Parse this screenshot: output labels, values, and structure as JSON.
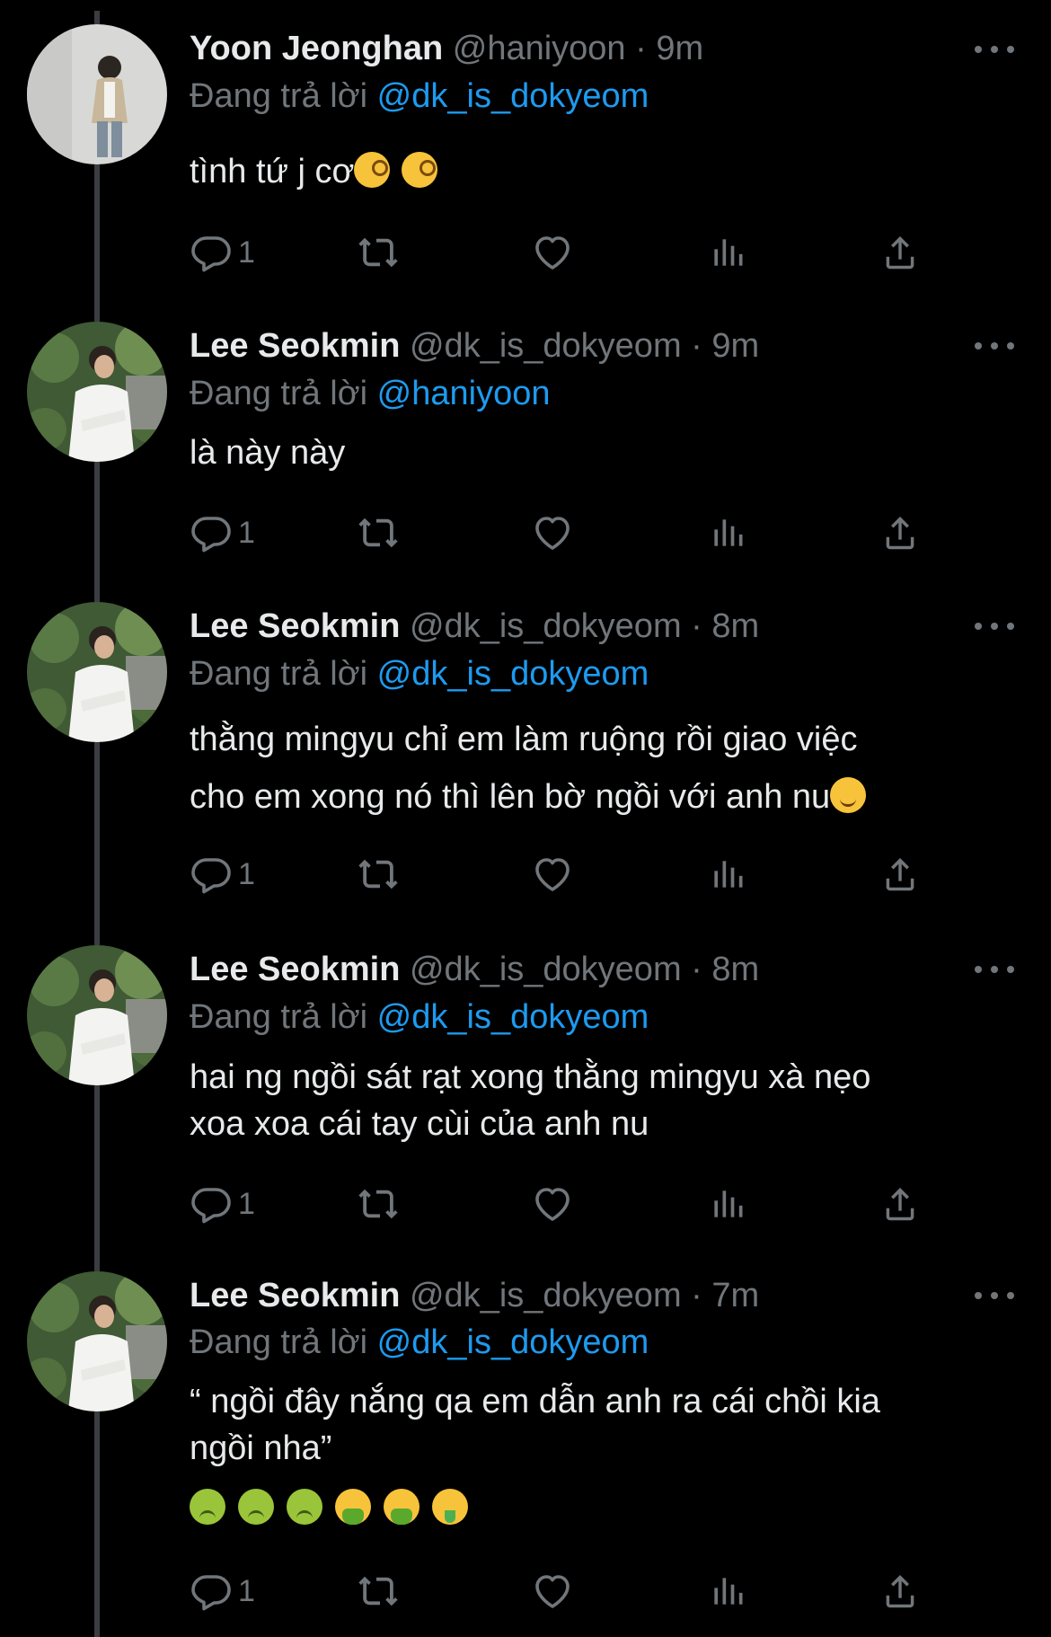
{
  "tweets": [
    {
      "name": "Yoon Jeonghan",
      "handle": "@haniyoon",
      "sep": " · ",
      "time": "9m",
      "reply_prefix": "Đang trả lời ",
      "reply_to": "@dk_is_dokyeom",
      "text_lines": [
        "tình tứ j cơ"
      ],
      "reply_count": "1",
      "avatar": "person-standing-avatar"
    },
    {
      "name": "Lee Seokmin",
      "handle": "@dk_is_dokyeom",
      "sep": " · ",
      "time": "9m",
      "reply_prefix": "Đang trả lời ",
      "reply_to": "@haniyoon",
      "text_lines": [
        "là này này"
      ],
      "reply_count": "1",
      "avatar": "person-white-shirt-avatar"
    },
    {
      "name": "Lee Seokmin",
      "handle": "@dk_is_dokyeom",
      "sep": " · ",
      "time": "8m",
      "reply_prefix": "Đang trả lời ",
      "reply_to": "@dk_is_dokyeom",
      "text_lines": [
        "thằng mingyu chỉ em làm ruộng rồi giao việc",
        "cho em xong nó thì lên bờ ngồi với anh nu"
      ],
      "reply_count": "1",
      "avatar": "person-white-shirt-avatar"
    },
    {
      "name": "Lee Seokmin",
      "handle": "@dk_is_dokyeom",
      "sep": " · ",
      "time": "8m",
      "reply_prefix": "Đang trả lời ",
      "reply_to": "@dk_is_dokyeom",
      "text_lines": [
        "hai ng ngồi sát rạt xong thằng mingyu xà nẹo",
        "xoa xoa cái tay cùi của anh nu"
      ],
      "reply_count": "1",
      "avatar": "person-white-shirt-avatar"
    },
    {
      "name": "Lee Seokmin",
      "handle": "@dk_is_dokyeom",
      "sep": " · ",
      "time": "7m",
      "reply_prefix": "Đang trả lời ",
      "reply_to": "@dk_is_dokyeom",
      "text_lines": [
        "“ ngồi đây nắng qa em dẫn anh ra cái chồi kia",
        "ngồi nha”"
      ],
      "reply_count": "1",
      "avatar": "person-white-shirt-avatar"
    }
  ],
  "icons": {
    "reply": "reply-bubble-icon",
    "retweet": "retweet-icon",
    "like": "heart-icon",
    "views": "views-bar-chart-icon",
    "share": "share-upload-icon",
    "more": "more-dots-icon"
  },
  "emojis": {
    "tweet0": [
      "face-with-monocle",
      "face-with-monocle"
    ],
    "tweet2": [
      "slightly-smiling-face"
    ],
    "tweet4": [
      "nauseated-face",
      "nauseated-face",
      "nauseated-face",
      "face-vomiting",
      "face-vomiting",
      "money-mouth-face"
    ]
  },
  "colors": {
    "background": "#000000",
    "text": "#e7e9ea",
    "secondary": "#71767b",
    "mention": "#1d9bf0",
    "thread_line": "#3a3d41"
  }
}
